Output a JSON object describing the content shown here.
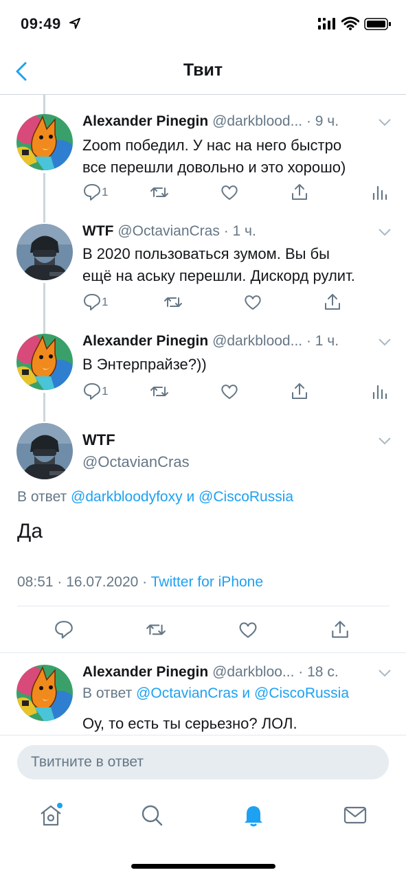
{
  "status_bar": {
    "time": "09:49",
    "icons": [
      "location-arrow-icon",
      "signal-icon",
      "wifi-icon",
      "battery-icon"
    ]
  },
  "header": {
    "title": "Твит",
    "back_icon": "chevron-left-icon"
  },
  "colors": {
    "accent": "#1da1f2",
    "text": "#14171a",
    "secondary": "#657786",
    "divider": "#e1e8ed"
  },
  "thread": [
    {
      "name": "Alexander Pinegin",
      "handle": "@darkblood...",
      "time": "· 9 ч.",
      "text": "Zoom победил. У нас на него быстро\nвсе перешли довольно и это хорошо)",
      "reply_count": "1",
      "avatar": "fox-avatar"
    },
    {
      "name": "WTF",
      "handle": "@OctavianCras",
      "time": "· 1 ч.",
      "text": "В 2020 пользоваться зумом. Вы бы\nещё на аську перешли. Дискорд рулит.",
      "reply_count": "1",
      "avatar": "soldier-avatar"
    },
    {
      "name": "Alexander Pinegin",
      "handle": "@darkblood...",
      "time": "· 1 ч.",
      "text": "В Энтерпрайзе?))",
      "reply_count": "1",
      "avatar": "fox-avatar"
    }
  ],
  "main_tweet": {
    "name": "WTF",
    "handle": "@OctavianCras",
    "reply_prefix": "В ответ",
    "reply_to_1": "@darkbloodyfoxy",
    "reply_joiner": "и",
    "reply_to_2": "@CiscoRussia",
    "text": "Да",
    "datetime": "08:51 · 16.07.2020 ·",
    "source": "Twitter for iPhone"
  },
  "reply": {
    "name": "Alexander Pinegin",
    "handle": "@darkbloo...",
    "time": "· 18 с.",
    "reply_prefix": "В ответ",
    "reply_to_1": "@OctavianCras",
    "reply_joiner": "и",
    "reply_to_2": "@CiscoRussia",
    "text": "Оу, то есть ты серьезно? ЛОЛ."
  },
  "composer": {
    "placeholder": "Твитните в ответ"
  },
  "tab_bar": [
    "home-icon",
    "search-icon",
    "notifications-icon",
    "messages-icon"
  ]
}
